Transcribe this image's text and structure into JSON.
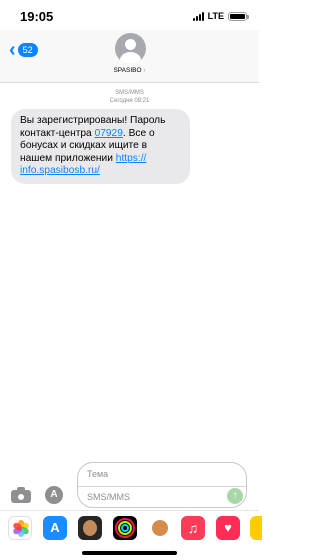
{
  "status_bar": {
    "time": "19:05",
    "network": "LTE"
  },
  "header": {
    "back_count": "52",
    "contact_name": "SPASIBO",
    "contact_chevron": "›"
  },
  "conversation": {
    "service_label": "SMS/MMS",
    "timestamp": "Сегодня 09:21",
    "message": {
      "text_part1": "Вы зарегистрированы! Пароль контакт-центра ",
      "code_link": "07929",
      "text_part2": ". Все о бонусах и скидках ищите в нашем приложении ",
      "url_link": "https:// info.spasibosb.ru/"
    }
  },
  "composer": {
    "subject_placeholder": "Тема",
    "message_placeholder": "SMS/MMS"
  },
  "app_drawer": {
    "icons": [
      "photos-icon",
      "app-store-icon",
      "memoji-icon",
      "fitness-icon",
      "memoji-icon",
      "music-icon",
      "heart-icon"
    ]
  },
  "colors": {
    "accent": "#0a84ff",
    "bubble": "#e9e9eb",
    "send_disabled": "#a8d8a8"
  }
}
